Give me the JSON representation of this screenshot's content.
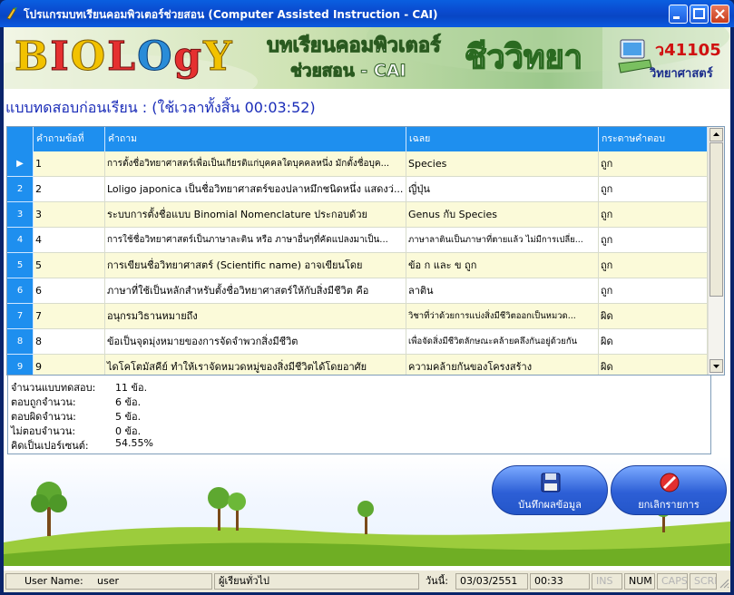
{
  "window": {
    "title": "โปรแกรมบทเรียนคอมพิวเตอร์ช่วยสอน (Computer Assisted Instruction - CAI)"
  },
  "banner": {
    "logo_text": "BIOLOGY",
    "thai_line1": "บทเรียนคอมพิวเตอร์",
    "thai_line2": "ช่วยสอน - CAI",
    "subject_big": "ชีววิทยา",
    "course_code": "ว41105",
    "course_subject": "วิทยาศาสตร์"
  },
  "test": {
    "heading": "แบบทดสอบก่อนเรียน : (ใช้เวลาทั้งสิ้น 00:03:52)"
  },
  "grid": {
    "columns": [
      "คำถามข้อที่",
      "คำถาม",
      "เฉลย",
      "กระดาษคำตอบ"
    ],
    "rows": [
      {
        "marker": "▶",
        "no": "1",
        "question": "การตั้งชื่อวิทยาศาสตร์เพื่อเป็นเกียรติแก่บุคคลใดบุคคลหนึ่ง มักตั้งชื่อบุค...",
        "answer": "Species",
        "result": "ถูก"
      },
      {
        "marker": "2",
        "no": "2",
        "question": "Loligo japonica เป็นชื่อวิทยาศาสตร์ของปลาหมึกชนิดหนึ่ง แสดงว่...",
        "answer": "ญี่ปุ่น",
        "result": "ถูก"
      },
      {
        "marker": "3",
        "no": "3",
        "question": "ระบบการตั้งชื่อแบบ Binomial Nomenclature ประกอบด้วย",
        "answer": "Genus กับ Species",
        "result": "ถูก"
      },
      {
        "marker": "4",
        "no": "4",
        "question": "การใช้ชื่อวิทยาศาสตร์เป็นภาษาละติน หรือ ภาษาอื่นๆที่คัดแปลงมาเป็น...",
        "answer": "ภาษาลาตินเป็นภาษาที่ตายแล้ว ไม่มีการเปลี่ย...",
        "result": "ถูก"
      },
      {
        "marker": "5",
        "no": "5",
        "question": "การเขียนชื่อวิทยาศาสตร์ (Scientific name) อาจเขียนโดย",
        "answer": "ข้อ ก และ ข ถูก",
        "result": "ถูก"
      },
      {
        "marker": "6",
        "no": "6",
        "question": "ภาษาที่ใช้เป็นหลักสำหรับตั้งชื่อวิทยาศาสตร์ให้กับสิ่งมีชีวิต คือ",
        "answer": "ลาติน",
        "result": "ถูก"
      },
      {
        "marker": "7",
        "no": "7",
        "question": "อนุกรมวิธานหมายถึง",
        "answer": "วิชาที่ว่าด้วยการแบ่งสิ่งมีชีวิตออกเป็นหมวด...",
        "result": "ผิด"
      },
      {
        "marker": "8",
        "no": "8",
        "question": "ข้อเป็นจุดมุ่งหมายของการจัดจำพวกสิ่งมีชีวิต",
        "answer": "เพื่อจัดสิ่งมีชีวิตลักษณะคล้ายคลึงกันอยู่ด้วยกัน",
        "result": "ผิด"
      },
      {
        "marker": "9",
        "no": "9",
        "question": "ไดโคโตมัสคีย์ ทำให้เราจัดหมวดหมู่ของสิ่งมีชีวิตได้โดยอาศัย",
        "answer": "ความคล้ายกันของโครงสร้าง",
        "result": "ผิด"
      }
    ]
  },
  "summary": {
    "lines": [
      {
        "label": "จำนวนแบบทดสอบ:",
        "value": "11 ข้อ."
      },
      {
        "label": "ตอบถูกจำนวน:",
        "value": "6 ข้อ."
      },
      {
        "label": "ตอบผิดจำนวน:",
        "value": "5 ข้อ."
      },
      {
        "label": "ไม่ตอบจำนวน:",
        "value": "0 ข้อ."
      },
      {
        "label": "คิดเป็นเปอร์เซนต์:",
        "value": "54.55%"
      }
    ]
  },
  "buttons": {
    "save_label": "บันทึกผลข้อมูล",
    "cancel_label": "ยกเลิกรายการ"
  },
  "status": {
    "user_label": "User Name:",
    "user_value": "user",
    "role": "ผู้เรียนทั่วไป",
    "date_label": "วันนี้:",
    "date": "03/03/2551",
    "time": "00:33",
    "ins": "INS",
    "num": "NUM",
    "caps": "CAPS",
    "scrl": "SCRL"
  },
  "colors": {
    "grid_header": "#1e8fef",
    "heading_text": "#1a2cb8",
    "row_alt": "#fbfad9",
    "button": "#2d5fd6"
  }
}
